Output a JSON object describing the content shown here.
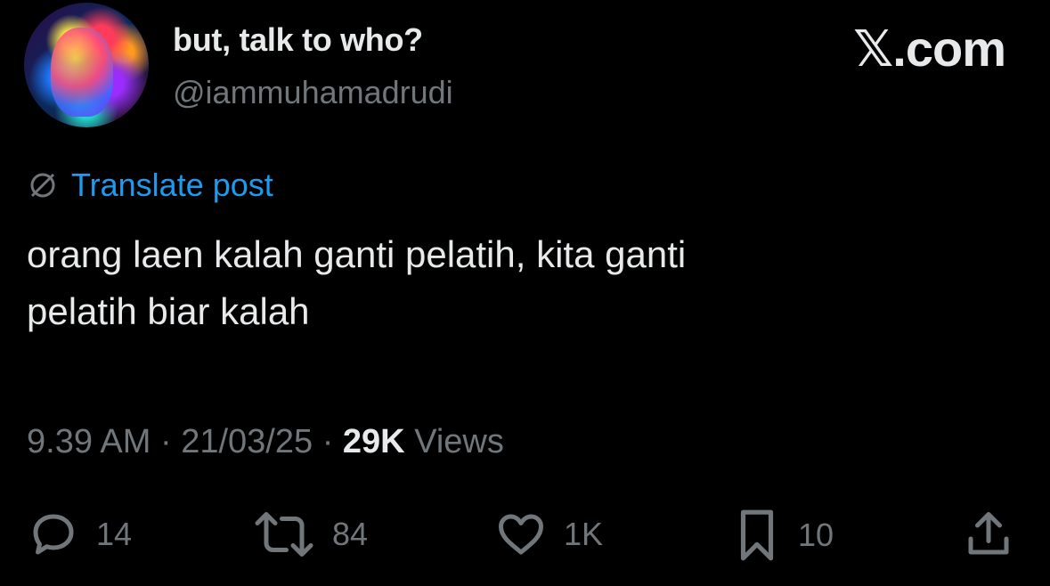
{
  "user": {
    "display_name": "but, talk to who?",
    "handle": "@iammuhamadrudi",
    "avatar_icon": "avatar-image"
  },
  "brand": "𝕏.com",
  "translate": {
    "icon": "globe-slash-icon",
    "label": "Translate post",
    "color": "#1d9bf0"
  },
  "post": {
    "text_line1": "orang laen kalah ganti pelatih, kita ganti",
    "text_line2": "pelatih biar kalah"
  },
  "meta": {
    "time": "9.39 AM",
    "date": "21/03/25",
    "views_count": "29K",
    "views_label": "Views",
    "separator": "·"
  },
  "actions": {
    "replies": {
      "icon": "reply-icon",
      "count": "14"
    },
    "reposts": {
      "icon": "repost-icon",
      "count": "84"
    },
    "likes": {
      "icon": "heart-icon",
      "count": "1K"
    },
    "bookmarks": {
      "icon": "bookmark-icon",
      "count": "10"
    },
    "share": {
      "icon": "share-icon"
    }
  },
  "colors": {
    "background": "#000000",
    "text": "#e7e9ea",
    "muted": "#71767b",
    "accent": "#1d9bf0"
  }
}
